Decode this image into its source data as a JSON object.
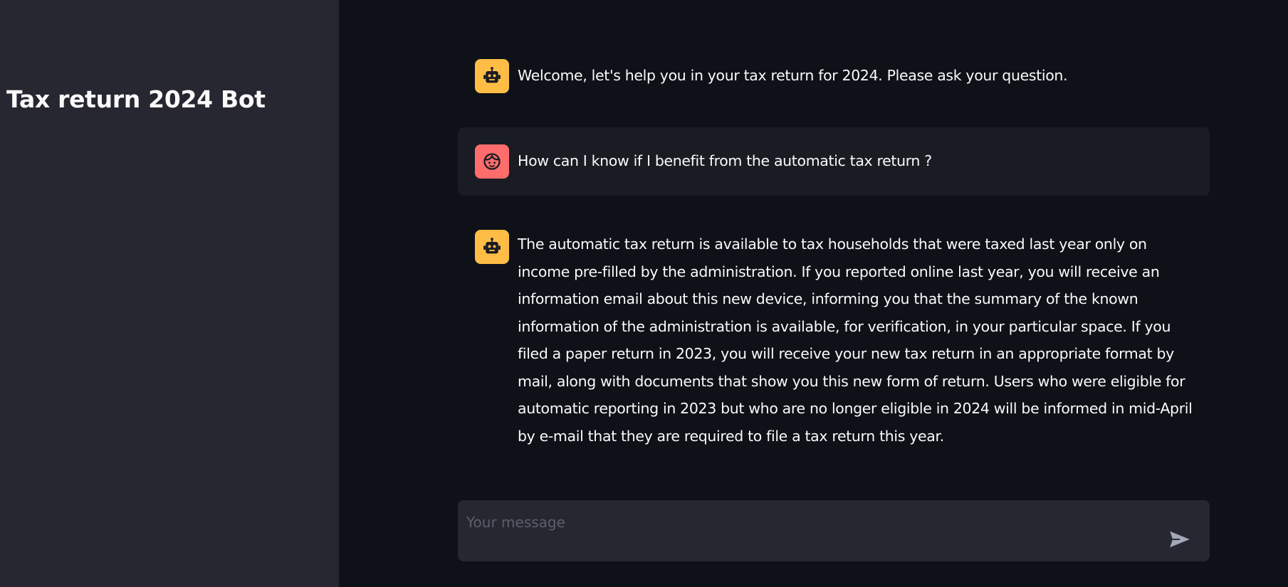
{
  "sidebar": {
    "title": "Tax return 2024 Bot"
  },
  "messages": [
    {
      "role": "assistant",
      "avatar_icon": "robot-icon",
      "text": "Welcome, let's help you in your tax return for 2024. Please ask your question."
    },
    {
      "role": "user",
      "avatar_icon": "user-face-icon",
      "text": "How can I know if I benefit from the automatic tax return ?"
    },
    {
      "role": "assistant",
      "avatar_icon": "robot-icon",
      "text": "The automatic tax return is available to tax households that were taxed last year only on income pre-filled by the administration. If you reported online last year, you will receive an information email about this new device, informing you that the summary of the known information of the administration is available, for verification, in your particular space. If you filed a paper return in 2023, you will receive your new tax return in an appropriate format by mail, along with documents that show you this new form of return. Users who were eligible for automatic reporting in 2023 but who are no longer eligible in 2024 will be informed in mid-April by e-mail that they are required to file a tax return this year."
    }
  ],
  "chat_input": {
    "placeholder": "Your message",
    "value": "",
    "send_icon": "send-icon"
  },
  "colors": {
    "main_background": "#0e1117",
    "sidebar_background": "#262730",
    "assistant_avatar": "#ffbd45",
    "user_avatar": "#ff6c6c",
    "user_message_background": "#1a1c24",
    "input_background": "#262730"
  }
}
